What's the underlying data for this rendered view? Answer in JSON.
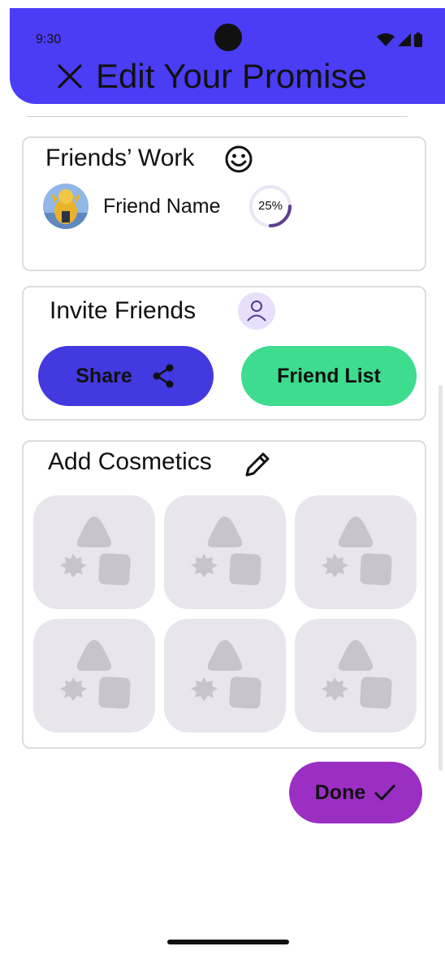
{
  "status": {
    "time": "9:30"
  },
  "header": {
    "title": "Edit Your Promise",
    "close_icon": "close-icon",
    "color": "#4a3df5"
  },
  "friends_work": {
    "title": "Friends’ Work",
    "title_icon": "smiley-icon",
    "friend": {
      "name": "Friend Name",
      "progress_label": "25%",
      "progress_value": 0.25
    }
  },
  "invite_friends": {
    "title": "Invite Friends",
    "title_icon": "person-icon",
    "share_label": "Share",
    "share_icon": "share-icon",
    "share_color": "#4339e0",
    "friend_list_label": "Friend List",
    "friend_list_color": "#3ddc8e"
  },
  "cosmetics": {
    "title": "Add Cosmetics",
    "title_icon": "pencil-icon",
    "tile_count": 6
  },
  "done": {
    "label": "Done",
    "icon": "check-icon",
    "color": "#9b2fc4"
  }
}
